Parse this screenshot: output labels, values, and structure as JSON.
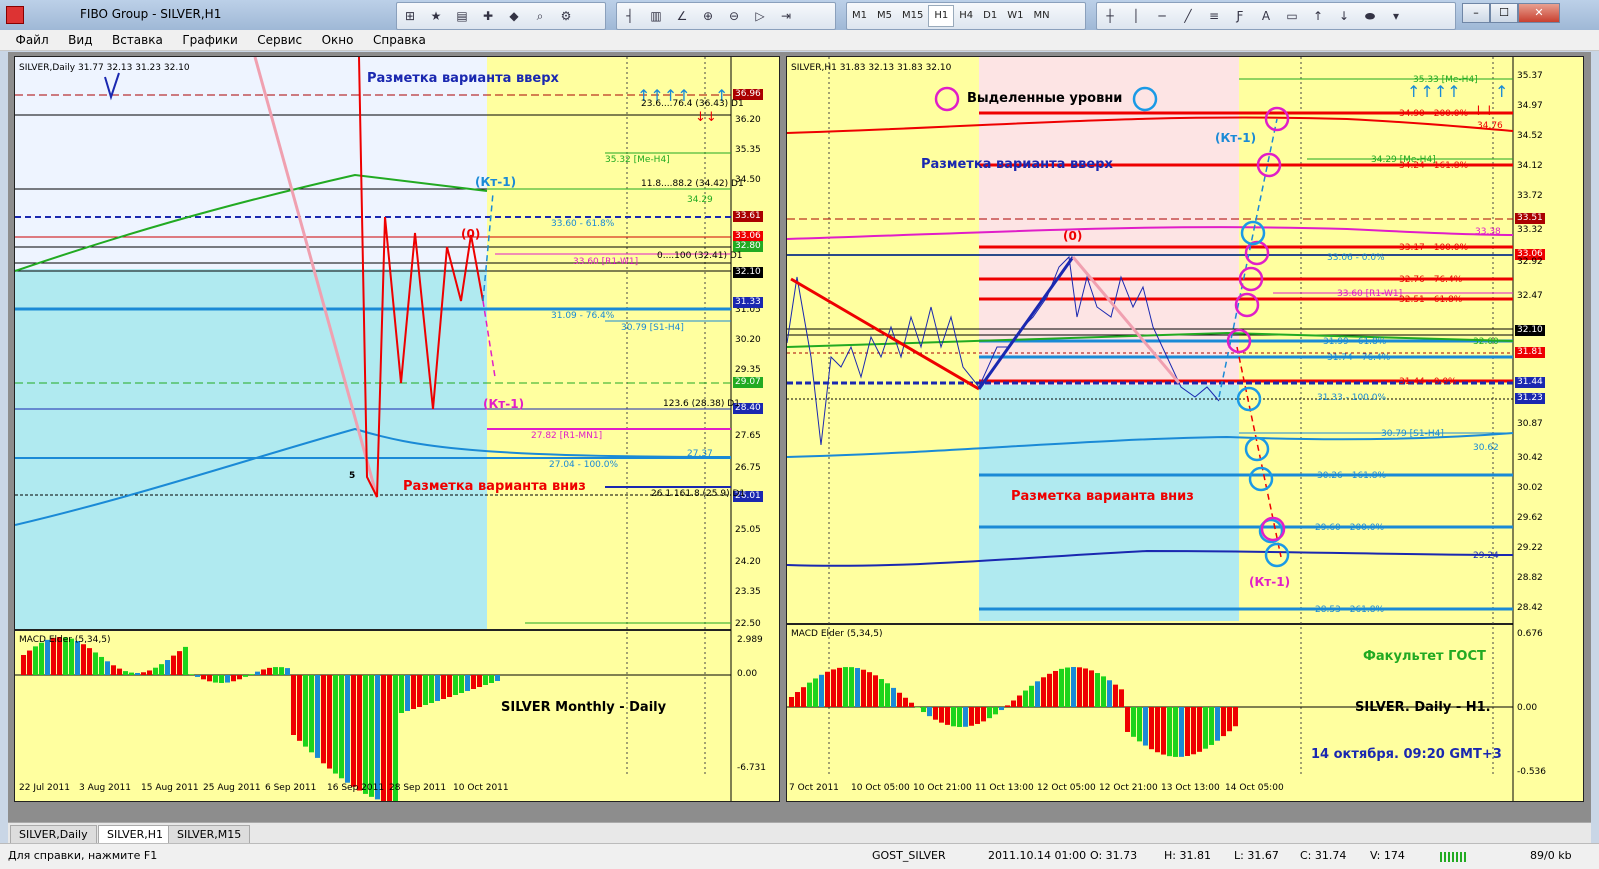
{
  "window": {
    "title": "FIBO Group - SILVER,H1",
    "minimize": "–",
    "maximize": "☐",
    "close": "✕"
  },
  "menu": [
    "Файл",
    "Вид",
    "Вставка",
    "Графики",
    "Сервис",
    "Окно",
    "Справка"
  ],
  "timeframes": [
    "M1",
    "M5",
    "M15",
    "H1",
    "H4",
    "D1",
    "W1",
    "MN"
  ],
  "toolbar_text": {
    "text_tool": "A"
  },
  "left": {
    "header": "SILVER,Daily  31.77 32.13 31.23 32.10",
    "title_up": "Разметка варианта вверх",
    "title_down": "Разметка варианта вниз",
    "kt_up": "(Кт-1)",
    "kt_down": "(Кт-1)",
    "zero": "(0)",
    "five": "5",
    "big_label": "SILVER  Monthly - Daily",
    "macd": "MACD Elder (5,34,5)",
    "levels": [
      {
        "t": "23.6....76.4 (36.43) D1",
        "c": "#000"
      },
      {
        "t": "35.32 [Me-H4]",
        "c": "#2a2"
      },
      {
        "t": "11.8....88.2 (34.42) D1",
        "c": "#000"
      },
      {
        "t": "34.29",
        "c": "#2a2"
      },
      {
        "t": "33.60 - 61.8%",
        "c": "#1a8ad6"
      },
      {
        "t": "0....100 (32.41) D1",
        "c": "#000"
      },
      {
        "t": "33.60 [R1-W1]",
        "c": "#e01ec8"
      },
      {
        "t": "31.09 - 76.4%",
        "c": "#1a8ad6"
      },
      {
        "t": "30.79 [S1-H4]",
        "c": "#1a8ad6"
      },
      {
        "t": "123.6 (28.38) D1",
        "c": "#000"
      },
      {
        "t": "27.82 [R1-MN1]",
        "c": "#e01ec8"
      },
      {
        "t": "27.37",
        "c": "#1a8ad6"
      },
      {
        "t": "27.04 - 100.0%",
        "c": "#1a8ad6"
      },
      {
        "t": "26.1 161.8 (25.9) D1",
        "c": "#000"
      }
    ],
    "price_scale": [
      "36.96",
      "36.20",
      "35.35",
      "34.50",
      "33.61",
      "33.06",
      "32.80",
      "32.10",
      "31.33",
      "31.05",
      "30.20",
      "29.35",
      "29.07",
      "28.40",
      "27.65",
      "26.75",
      "26.01",
      "25.05",
      "24.20",
      "23.35",
      "22.50"
    ],
    "macd_scale": [
      "2.989",
      "0.00",
      "-6.731"
    ],
    "time_axis": [
      "22 Jul 2011",
      "3 Aug 2011",
      "15 Aug 2011",
      "25 Aug 2011",
      "6 Sep 2011",
      "16 Sep 2011",
      "28 Sep 2011",
      "10 Oct 2011"
    ]
  },
  "right": {
    "header": "SILVER,H1  31.83 32.13 31.83 32.10",
    "legend_levels": "Выделенные уровни",
    "title_up": "Разметка варианта вверх",
    "title_down": "Разметка варианта вниз",
    "kt_up": "(Кт-1)",
    "kt_down": "(Кт-1)",
    "zero": "(0)",
    "faculty": "Факультет ГОСТ",
    "desc": "SILVER. Daily - H1.",
    "date": "14 октября. 09:20 GMT+3",
    "macd": "MACD Elder (5,34,5)",
    "levels": [
      {
        "t": "35.33 [Me-H4]",
        "c": "#2a2"
      },
      {
        "t": "34.90 - 200.0%",
        "c": "#e00"
      },
      {
        "t": "34.76",
        "c": "#e00"
      },
      {
        "t": "34.29 [Me-H4]",
        "c": "#2a2"
      },
      {
        "t": "34.24 - 161.8%",
        "c": "#e00"
      },
      {
        "t": "33.38",
        "c": "#e01ec8"
      },
      {
        "t": "33.17 - 100.0%",
        "c": "#e00"
      },
      {
        "t": "33.06 - 0.0%",
        "c": "#1a8ad6"
      },
      {
        "t": "32.76 - 76.4%",
        "c": "#e00"
      },
      {
        "t": "33.60 [R1-W1]",
        "c": "#e01ec8"
      },
      {
        "t": "32.51 - 61.8%",
        "c": "#e00"
      },
      {
        "t": "31.99 - 61.8%",
        "c": "#1a8ad6"
      },
      {
        "t": "32.00",
        "c": "#2a2"
      },
      {
        "t": "31.74 - 76.4%",
        "c": "#1a8ad6"
      },
      {
        "t": "31.44 - 0.0%",
        "c": "#e00"
      },
      {
        "t": "31.33 - 100.0%",
        "c": "#1a8ad6"
      },
      {
        "t": "30.79 [S1-H4]",
        "c": "#1a8ad6"
      },
      {
        "t": "30.62",
        "c": "#1a8ad6"
      },
      {
        "t": "30.26 - 161.8%",
        "c": "#1a8ad6"
      },
      {
        "t": "29.60 - 200.0%",
        "c": "#1a8ad6"
      },
      {
        "t": "29.24",
        "c": "#1a28b0"
      },
      {
        "t": "28.53 - 261.8%",
        "c": "#1a8ad6"
      }
    ],
    "price_scale": [
      "35.37",
      "34.97",
      "34.52",
      "34.12",
      "33.72",
      "33.51",
      "33.32",
      "33.06",
      "32.92",
      "32.47",
      "32.10",
      "31.81",
      "31.44",
      "31.23",
      "30.87",
      "30.42",
      "30.02",
      "29.62",
      "29.22",
      "28.82",
      "28.42"
    ],
    "macd_scale": [
      "0.676",
      "0.00",
      "-0.536"
    ],
    "time_axis": [
      "7 Oct 2011",
      "10 Oct 05:00",
      "10 Oct 21:00",
      "11 Oct 13:00",
      "12 Oct 05:00",
      "12 Oct 21:00",
      "13 Oct 13:00",
      "14 Oct 05:00"
    ]
  },
  "tabs": [
    "SILVER,Daily",
    "SILVER,H1",
    "SILVER,M15"
  ],
  "status": {
    "help": "Для справки, нажмите F1",
    "profile": "GOST_SILVER",
    "datetime": "2011.10.14 01:00",
    "o": "O: 31.73",
    "h": "H: 31.81",
    "l": "L: 31.67",
    "c": "C: 31.74",
    "v": "V: 174",
    "traffic": "89/0 kb"
  }
}
